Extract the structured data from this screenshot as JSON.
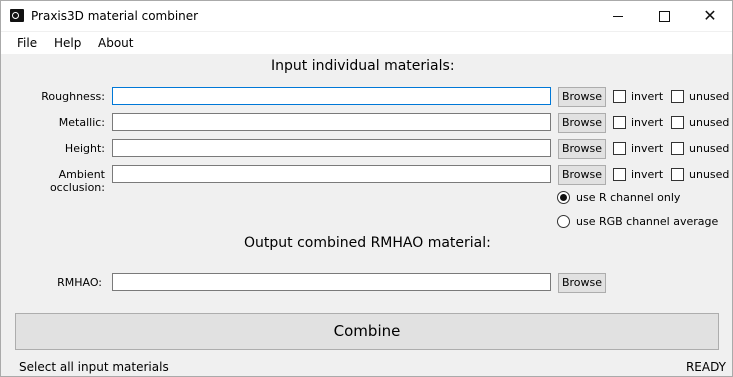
{
  "window": {
    "title": "Praxis3D material combiner",
    "minimize_icon": "minimize-icon",
    "maximize_icon": "maximize-icon",
    "close_icon": "close-icon"
  },
  "menu": [
    "File",
    "Help",
    "About"
  ],
  "input_section": {
    "title": "Input individual materials:"
  },
  "inputs": [
    {
      "label": "Roughness:",
      "value": "",
      "browse": "Browse",
      "invert": "invert",
      "unused": "unused"
    },
    {
      "label": "Metallic:",
      "value": "",
      "browse": "Browse",
      "invert": "invert",
      "unused": "unused"
    },
    {
      "label": "Height:",
      "value": "",
      "browse": "Browse",
      "invert": "invert",
      "unused": "unused"
    },
    {
      "label": "Ambient occlusion:",
      "value": "",
      "browse": "Browse",
      "invert": "invert",
      "unused": "unused"
    }
  ],
  "channel_options": [
    {
      "label": "use R channel only",
      "checked": true
    },
    {
      "label": "use RGB channel average",
      "checked": false
    }
  ],
  "output_section": {
    "title": "Output combined RMHAO material:",
    "label": "RMHAO:",
    "value": "",
    "browse": "Browse"
  },
  "combine_label": "Combine",
  "status": {
    "message": "Select all input materials",
    "state": "READY"
  }
}
